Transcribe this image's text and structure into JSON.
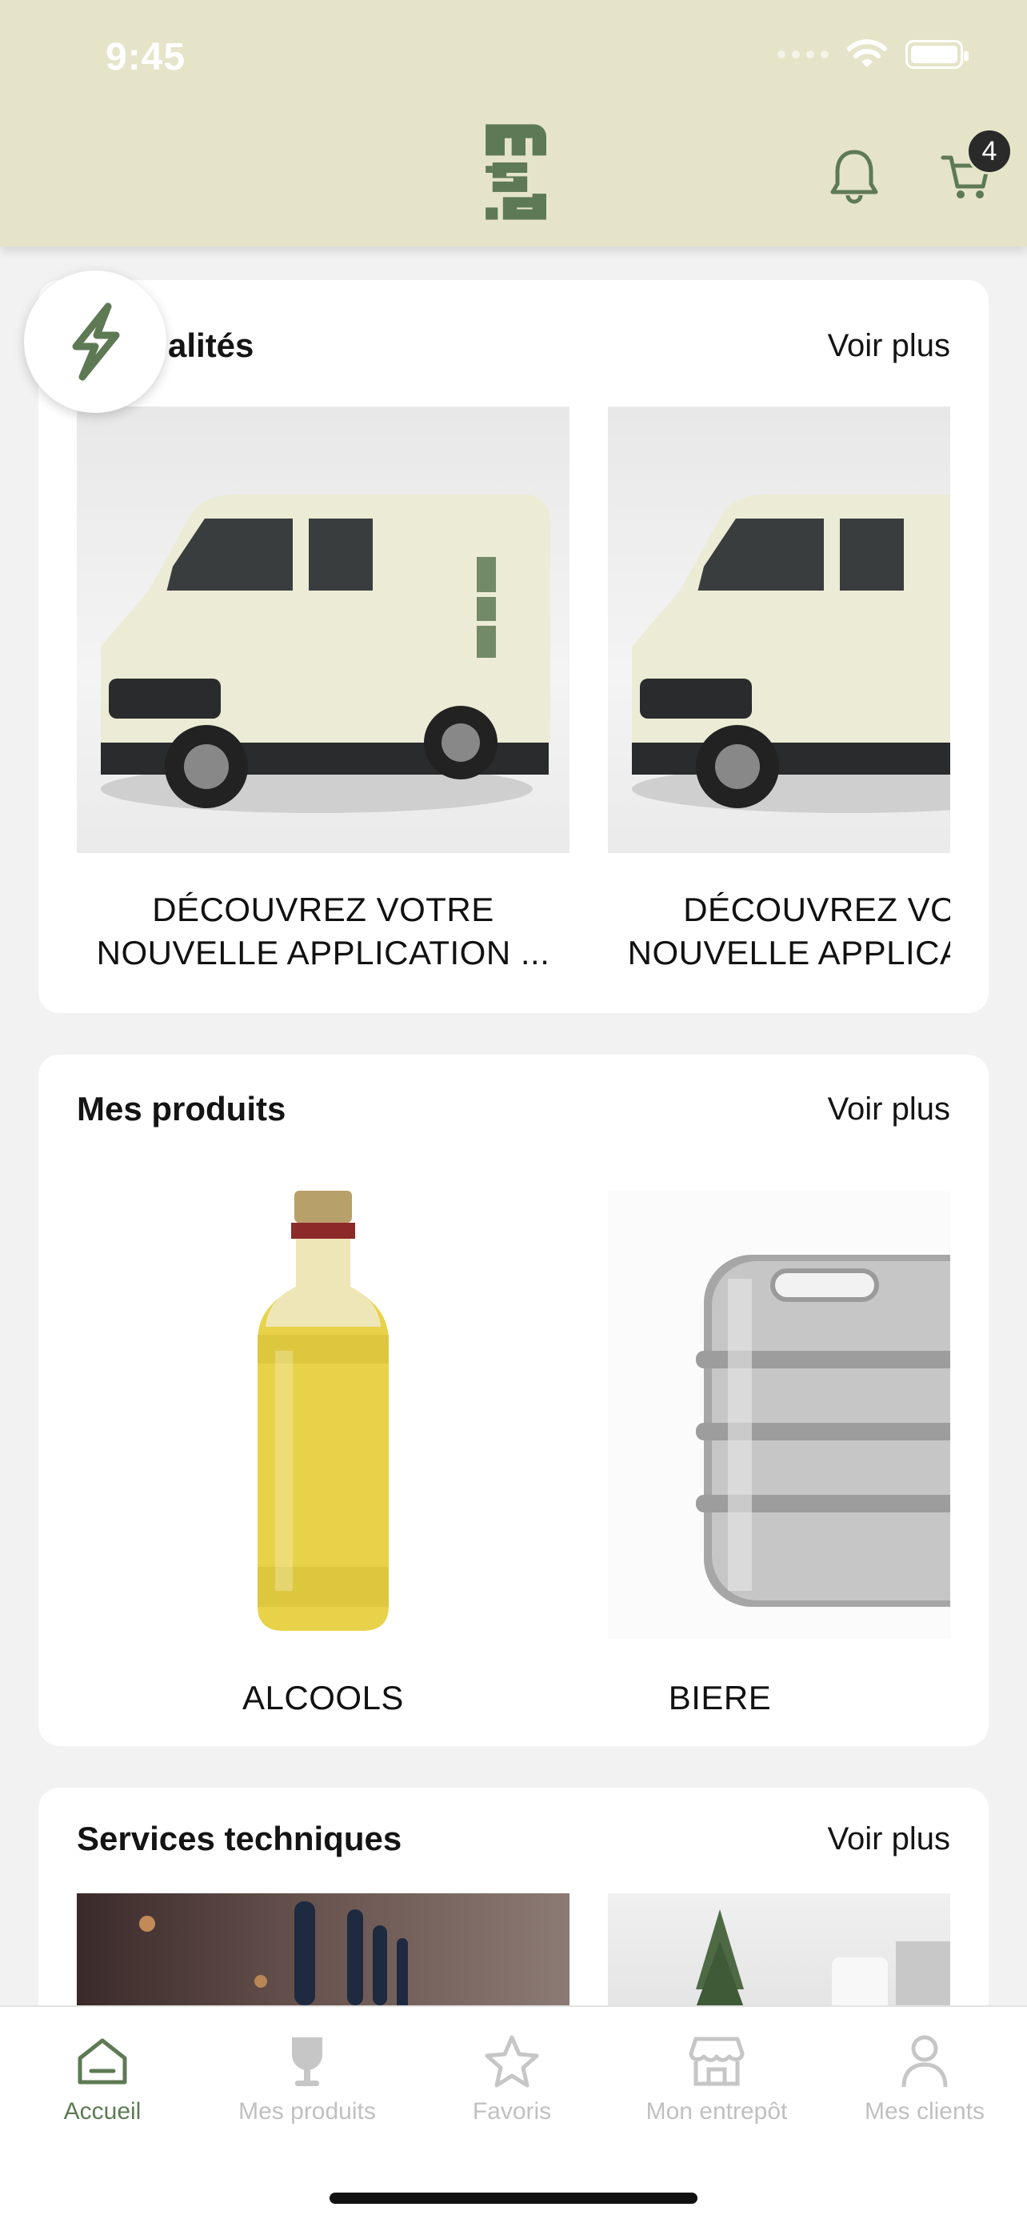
{
  "status": {
    "time": "9:45"
  },
  "header": {
    "cart_count": "4"
  },
  "news": {
    "title": "Actualités",
    "title_visible": "alités",
    "more": "Voir plus",
    "items": [
      {
        "caption_line1": "DÉCOUVREZ VOTRE",
        "caption_line2": "NOUVELLE APPLICATION ..."
      },
      {
        "caption_line1": "DÉCOUVREZ VOTRE",
        "caption_line2": "NOUVELLE APPLICATION ..."
      }
    ]
  },
  "products": {
    "title": "Mes produits",
    "more": "Voir plus",
    "items": [
      {
        "label": "ALCOOLS"
      },
      {
        "label": "BIERE"
      }
    ]
  },
  "services": {
    "title": "Services techniques",
    "more": "Voir plus"
  },
  "tabs": [
    {
      "label": "Accueil",
      "icon": "home-icon",
      "active": true
    },
    {
      "label": "Mes produits",
      "icon": "wine-glass-icon",
      "active": false
    },
    {
      "label": "Favoris",
      "icon": "star-icon",
      "active": false
    },
    {
      "label": "Mon entrepôt",
      "icon": "store-icon",
      "active": false
    },
    {
      "label": "Mes clients",
      "icon": "user-icon",
      "active": false
    }
  ],
  "colors": {
    "header_bg": "#e5e4c9",
    "accent": "#5e7a54",
    "inactive": "#c0c0c0"
  }
}
